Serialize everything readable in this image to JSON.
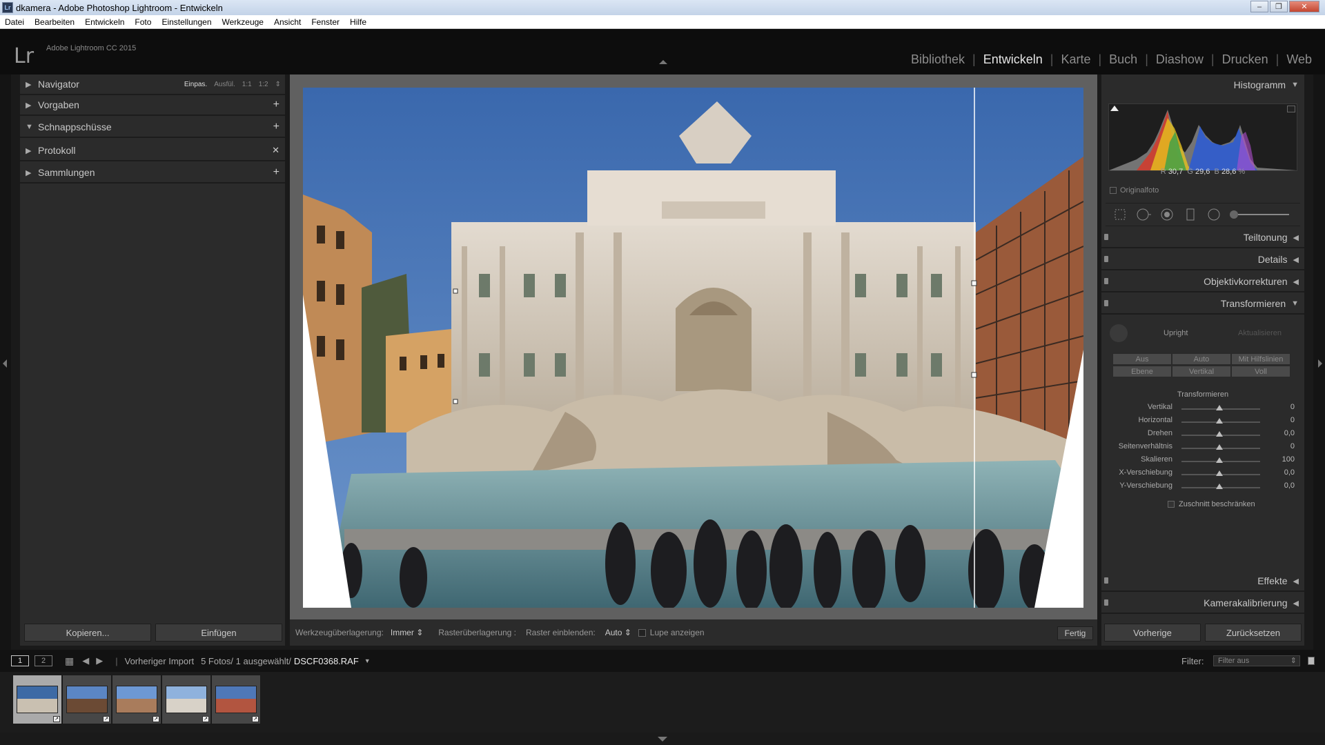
{
  "window": {
    "title": "dkamera - Adobe Photoshop Lightroom - Entwickeln",
    "icon_text": "Lr"
  },
  "menu": [
    "Datei",
    "Bearbeiten",
    "Entwickeln",
    "Foto",
    "Einstellungen",
    "Werkzeuge",
    "Ansicht",
    "Fenster",
    "Hilfe"
  ],
  "header": {
    "logo": "Lr",
    "app_name": "Adobe Lightroom CC 2015",
    "modules": [
      "Bibliothek",
      "Entwickeln",
      "Karte",
      "Buch",
      "Diashow",
      "Drucken",
      "Web"
    ],
    "active_module": "Entwickeln"
  },
  "left_panel": {
    "navigator": {
      "label": "Navigator",
      "options": [
        "Einpas.",
        "Ausfül.",
        "1:1",
        "1:2"
      ],
      "selected": "Einpas.",
      "arrow": "⇕"
    },
    "sections": [
      {
        "label": "Vorgaben",
        "action": "+",
        "expanded": false
      },
      {
        "label": "Schnappschüsse",
        "action": "+",
        "expanded": true
      },
      {
        "label": "Protokoll",
        "action": "✕",
        "expanded": false
      },
      {
        "label": "Sammlungen",
        "action": "+",
        "expanded": false
      }
    ],
    "copy_button": "Kopieren...",
    "paste_button": "Einfügen"
  },
  "toolbar": {
    "overlay_label": "Werkzeugüberlagerung:",
    "overlay_value": "Immer ⇕",
    "grid_label": "Rasterüberlagerung :",
    "grid_show_label": "Raster einblenden:",
    "grid_show_value": "Auto ⇕",
    "loupe_label": "Lupe anzeigen",
    "done_button": "Fertig"
  },
  "right_panel": {
    "histogram": {
      "label": "Histogramm",
      "r_label": "R",
      "r": "30,7",
      "g_label": "G",
      "g": "29,6",
      "b_label": "B",
      "b": "28,6",
      "unit": "%",
      "original_label": "Originalfoto"
    },
    "sections": [
      "Teiltonung",
      "Details",
      "Objektivkorrekturen"
    ],
    "transform": {
      "label": "Transformieren",
      "upright_label": "Upright",
      "update_label": "Aktualisieren",
      "upright_buttons_row1": [
        "Aus",
        "Auto",
        "Mit Hilfslinien"
      ],
      "upright_buttons_row2": [
        "Ebene",
        "Vertikal",
        "Voll"
      ],
      "sub_label": "Transformieren",
      "sliders": [
        {
          "name": "Vertikal",
          "value": "0"
        },
        {
          "name": "Horizontal",
          "value": "0"
        },
        {
          "name": "Drehen",
          "value": "0,0"
        },
        {
          "name": "Seitenverhältnis",
          "value": "0"
        },
        {
          "name": "Skalieren",
          "value": "100"
        },
        {
          "name": "X-Verschiebung",
          "value": "0,0"
        },
        {
          "name": "Y-Verschiebung",
          "value": "0,0"
        }
      ],
      "constrain_label": "Zuschnitt beschränken"
    },
    "sections_bottom": [
      "Effekte",
      "Kamerakalibrierung"
    ],
    "previous_button": "Vorherige",
    "reset_button": "Zurücksetzen"
  },
  "filmstrip_bar": {
    "screen1": "1",
    "screen2": "2",
    "source": "Vorheriger Import",
    "count": "5 Fotos/ 1 ausgewählt/",
    "filename": "DSCF0368.RAF",
    "filter_label": "Filter:",
    "filter_value": "Filter aus"
  },
  "thumbnails": [
    {
      "selected": true,
      "sky": "#3d6aa5",
      "ground": "#c9c0b1"
    },
    {
      "selected": false,
      "sky": "#5b86c4",
      "ground": "#6b4a34"
    },
    {
      "selected": false,
      "sky": "#6d98d4",
      "ground": "#a97c5c"
    },
    {
      "selected": false,
      "sky": "#8fb2dd",
      "ground": "#d8d2c8"
    },
    {
      "selected": false,
      "sky": "#4f78b8",
      "ground": "#b25540"
    }
  ]
}
